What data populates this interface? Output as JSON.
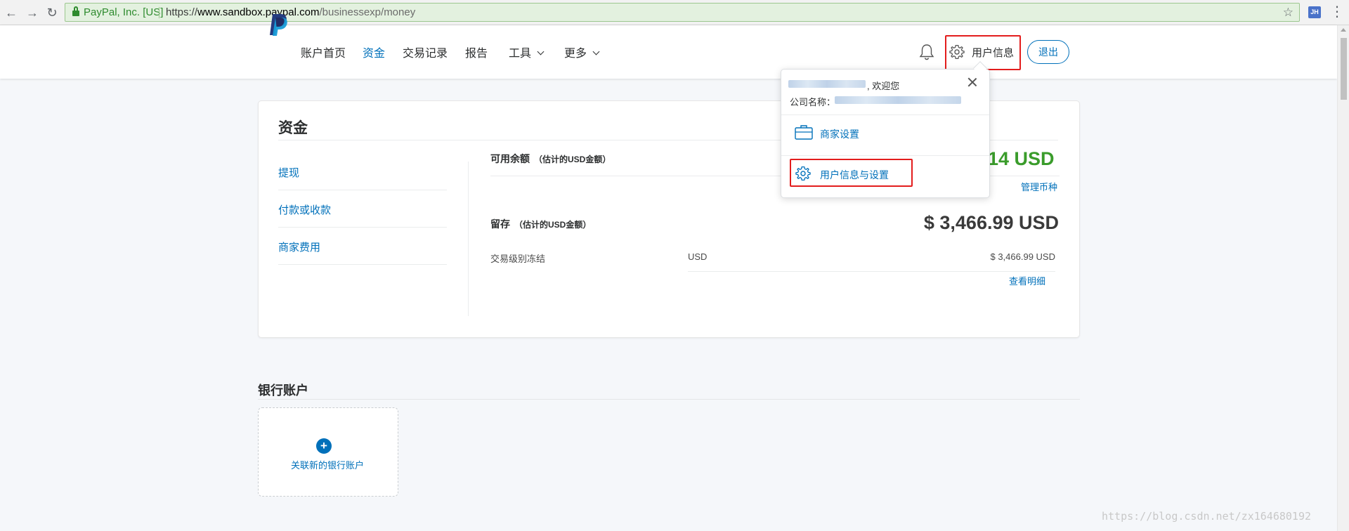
{
  "browser": {
    "ev_name": "PayPal, Inc. [US]",
    "url_scheme": "https://",
    "url_host": "www.sandbox.paypal.com",
    "url_path": "/businessexp/money",
    "extension_badge": "JH"
  },
  "topnav": {
    "items": [
      {
        "label": "账户首页"
      },
      {
        "label": "资金",
        "active": true
      },
      {
        "label": "交易记录"
      },
      {
        "label": "报告"
      },
      {
        "label": "工具",
        "has_dropdown": true
      },
      {
        "label": "更多",
        "has_dropdown": true
      }
    ],
    "user_info_label": "用户信息",
    "logout_label": "退出"
  },
  "dropdown": {
    "welcome": ", 欢迎您",
    "company_label": "公司名称：",
    "merchant_settings": "商家设置",
    "profile_settings": "用户信息与设置"
  },
  "money": {
    "title": "资金",
    "side_links": [
      "提现",
      "付款或收款",
      "商家费用"
    ],
    "available": {
      "label": "可用余额",
      "note": "（估计的USD金额）",
      "amount_visible": "14 USD",
      "manage_currencies": "管理币种"
    },
    "hold": {
      "label": "留存",
      "note": "（估计的USD金额）",
      "amount": "$ 3,466.99 USD",
      "row": {
        "type": "交易级别冻结",
        "currency": "USD",
        "amount": "$ 3,466.99 USD"
      },
      "view_details": "查看明细"
    }
  },
  "bank": {
    "title": "银行账户",
    "link_label": "关联新的银行账户",
    "plus": "+"
  },
  "watermark": "https://blog.csdn.net/zx164680192",
  "colors": {
    "brand_blue": "#0070ba",
    "positive_green": "#3a9c2b",
    "highlight_red": "#e31d1d"
  }
}
